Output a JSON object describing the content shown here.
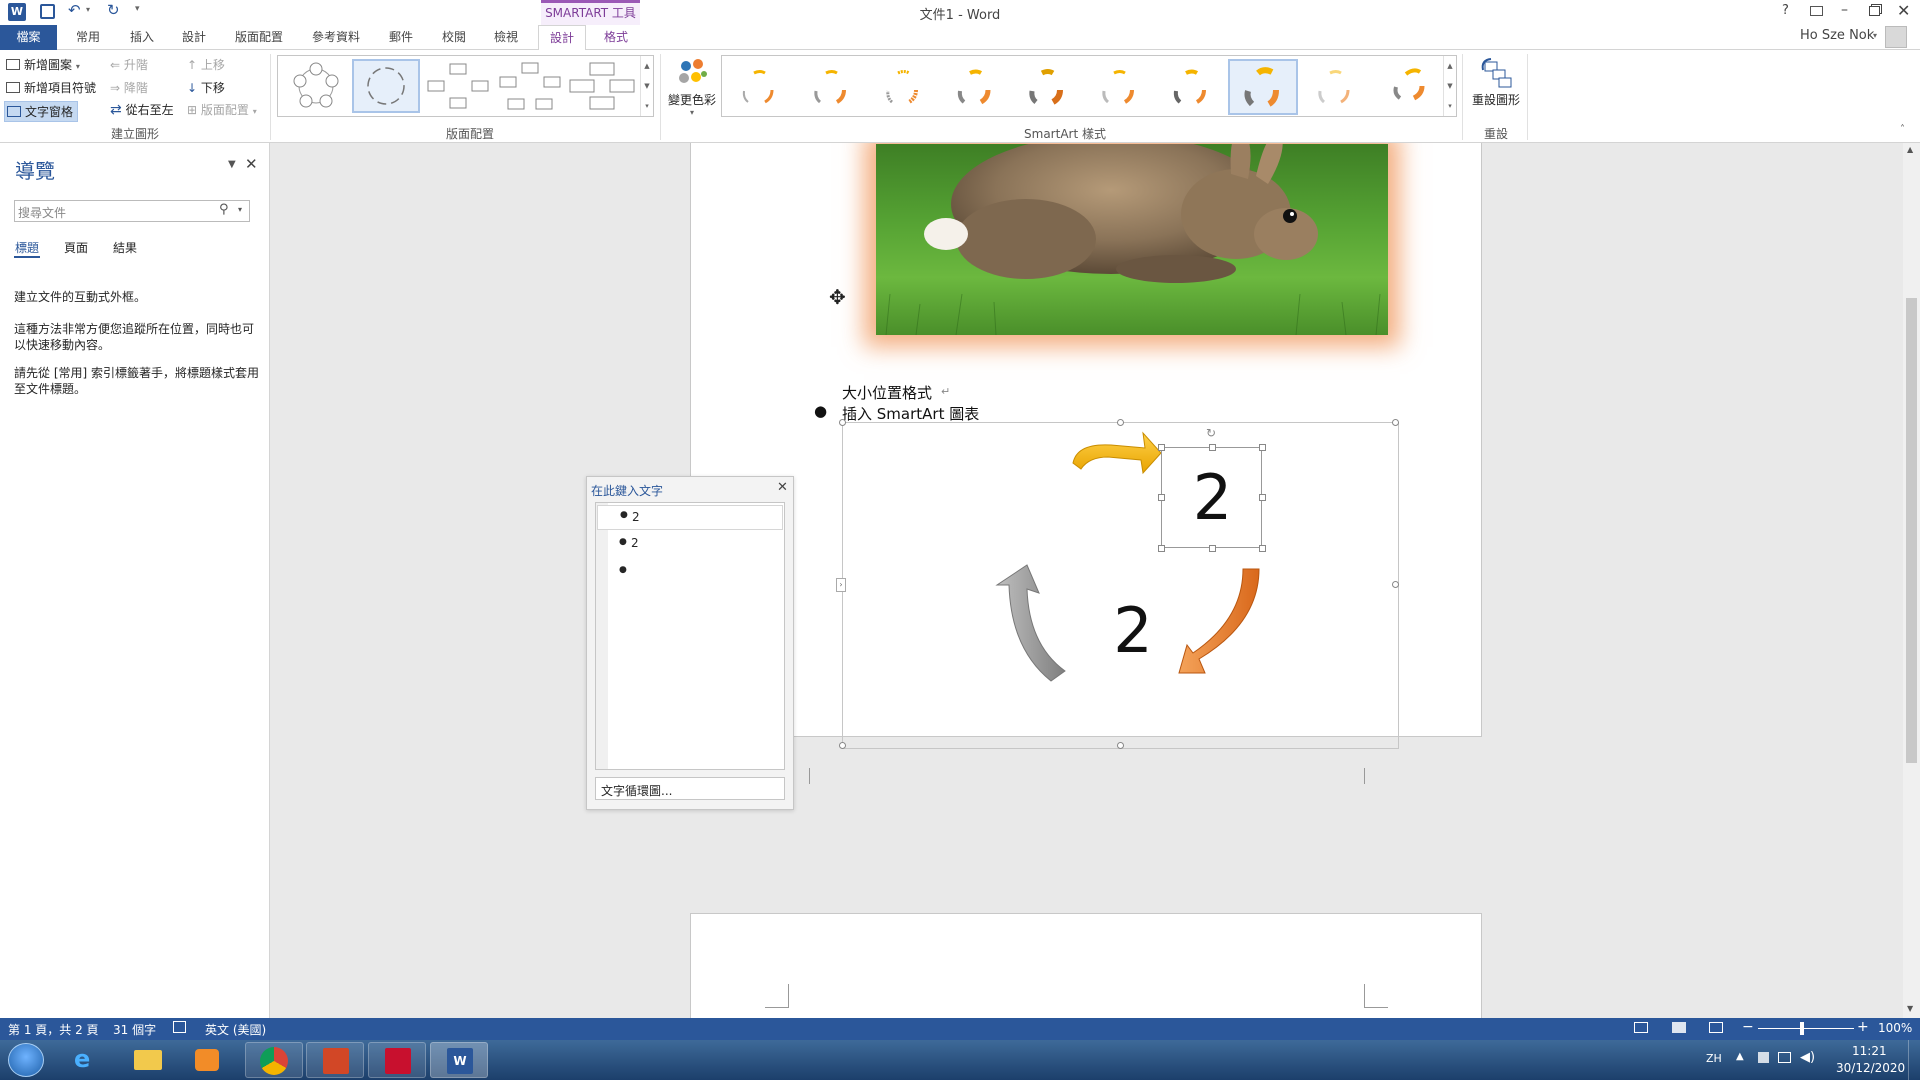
{
  "window": {
    "title": "文件1 - Word",
    "contextual_group": "SMARTART 工具",
    "help": "?",
    "user": "Ho Sze Nok",
    "accent": "#2b579a",
    "context_accent": "#9b59b6"
  },
  "tabs": [
    {
      "label": "檔案"
    },
    {
      "label": "常用"
    },
    {
      "label": "插入"
    },
    {
      "label": "設計"
    },
    {
      "label": "版面配置"
    },
    {
      "label": "參考資料"
    },
    {
      "label": "郵件"
    },
    {
      "label": "校閱"
    },
    {
      "label": "檢視"
    },
    {
      "label": "設計"
    },
    {
      "label": "格式"
    }
  ],
  "ribbon": {
    "create_graphic": {
      "add_shape": "新增圖案",
      "add_bullet": "新增項目符號",
      "text_pane": "文字窗格",
      "promote": "升階",
      "demote": "降階",
      "right_to_left": "從右至左",
      "move_up": "上移",
      "move_down": "下移",
      "layout": "版面配置",
      "group_label": "建立圖形"
    },
    "layouts_label": "版面配置",
    "change_colors": "變更色彩",
    "styles_label": "SmartArt 樣式",
    "reset_graphic": "重設圖形",
    "reset_label": "重設"
  },
  "nav": {
    "title": "導覽",
    "search_placeholder": "搜尋文件",
    "tabs": [
      {
        "label": "標題"
      },
      {
        "label": "頁面"
      },
      {
        "label": "結果"
      }
    ],
    "para1": "建立文件的互動式外框。",
    "para2": "這種方法非常方便您追蹤所在位置，同時也可以快速移動內容。",
    "para3": "請先從 [常用] 索引標籤著手，將標題樣式套用至文件標題。"
  },
  "doc": {
    "line1": "大小位置格式",
    "line2": "插入 SmartArt  圖表"
  },
  "text_pane": {
    "title": "在此鍵入文字",
    "items": [
      {
        "text": "2"
      },
      {
        "text": "2"
      },
      {
        "text": ""
      }
    ],
    "footer_link": "文字循環圖..."
  },
  "smartart": {
    "shape_top_text": "2",
    "shape_bottom_text": "2",
    "arrow_colors": [
      "#f5b400",
      "#ee8a2f",
      "#9c9c9c"
    ]
  },
  "status": {
    "page": "第 1 頁，共 2 頁",
    "words": "31 個字",
    "language": "英文 (美國)",
    "zoom": "100%"
  },
  "taskbar": {
    "ime": "ZH",
    "time": "11:21",
    "date": "30/12/2020"
  }
}
